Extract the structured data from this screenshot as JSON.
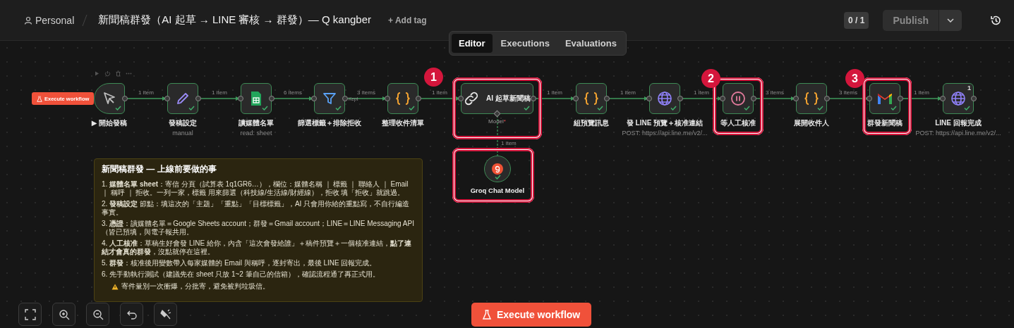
{
  "header": {
    "project": "Personal",
    "title": "新聞稿群發（AI 起草 → LINE 審核 → 群發）— Q kangber",
    "add_tag": "+ Add tag",
    "tabs": [
      {
        "label": "Editor",
        "selected": true
      },
      {
        "label": "Executions",
        "selected": false
      },
      {
        "label": "Evaluations",
        "selected": false
      }
    ],
    "counter": "0 / 1",
    "publish": {
      "label": "Publish",
      "disabled": true
    }
  },
  "canvas": {
    "execute_small": "Execute workflow",
    "nodes": [
      {
        "kind": "trigger",
        "label": "▶ 開始發稿",
        "success": true
      },
      {
        "kind": "set",
        "label": "發稿設定",
        "subtitle": "manual",
        "success": true
      },
      {
        "kind": "sheets",
        "label": "讀媒體名單",
        "subtitle": "read: sheet",
        "success": true
      },
      {
        "kind": "filter",
        "label": "篩選標籤＋排除拒收",
        "success": true
      },
      {
        "kind": "code",
        "label": "整理收件清單",
        "success": true
      },
      {
        "kind": "agent",
        "label": "AI 起草新聞稿",
        "success": true
      },
      {
        "kind": "code",
        "label": "組預覽訊息",
        "success": true
      },
      {
        "kind": "http",
        "label": "發 LINE 預覽＋核准連結",
        "subtitle": "POST: https://api.line.me/v2/...",
        "success": true
      },
      {
        "kind": "wait",
        "label": "等人工核准",
        "success": true
      },
      {
        "kind": "code",
        "label": "展開收件人",
        "success": true
      },
      {
        "kind": "gmail",
        "label": "群發新聞稿",
        "success": true
      },
      {
        "kind": "http",
        "label": "LINE 回報完成",
        "subtitle": "POST: https://api.line.me/v2/...",
        "badge": "1",
        "success": true
      }
    ],
    "connections": [
      {
        "label": "1 item"
      },
      {
        "label": "1 item"
      },
      {
        "label": "6 items"
      },
      {
        "label": "3 items",
        "output": "Kept"
      },
      {
        "label": "1 item"
      },
      {
        "label": "1 item"
      },
      {
        "label": "1 item"
      },
      {
        "label": "1 item"
      },
      {
        "label": "3 items"
      },
      {
        "label": "3 items"
      },
      {
        "label": "1 item"
      }
    ],
    "model_port": {
      "label": "Model",
      "required_mark": "*"
    },
    "model_connection": {
      "label": "1 item"
    },
    "model_node": {
      "label": "Groq Chat Model",
      "success": true
    },
    "annotations": [
      {
        "kind": "numbered",
        "number": "1"
      },
      {
        "kind": "numbered",
        "number": "2"
      },
      {
        "kind": "numbered",
        "number": "3"
      },
      {
        "kind": "box"
      }
    ],
    "sticky": {
      "title": "新聞稿群發 — 上線前要做的事",
      "items": [
        "1. **媒體名單 sheet**：寄信 分頁（試算表 1q1GR6…），欄位：媒體名稱 ｜ 標籤 ｜ 聯絡人 ｜ Email ｜ 稱呼 ｜ 拒收。一列一家，標籤 用來篩選（科技線/生活線/財經線），拒收 填「拒收」就跳過。",
        "2. **發稿設定** 節點：填這次的「主題」「重點」「目標標籤」，AI 只會用你給的重點寫，不自行編造事實。",
        "3. **憑證**：讀媒體名單＝Google Sheets account；群發＝Gmail account；LINE＝LINE Messaging API（皆已預填，與電子報共用。",
        "4. **人工核准**：草稿生好會發 LINE 給你，內含「這次會發給誰」＋稿件預覽＋一個核准連結，**點了連結才會真的群發**，沒點就停在這裡。",
        "5. **群發**：核准後用變數帶入每家媒體的 Email 與稱呼，逐封寄出，最後 LINE 回報完成。",
        "6. 先手動執行測試（建議先在 sheet 只放 1~2 筆自己的信箱），確認流程通了再正式用。"
      ],
      "warning": "寄件量別一次衝爆，分批寄，避免被判垃圾信。"
    },
    "execute_button": "Execute workflow"
  }
}
